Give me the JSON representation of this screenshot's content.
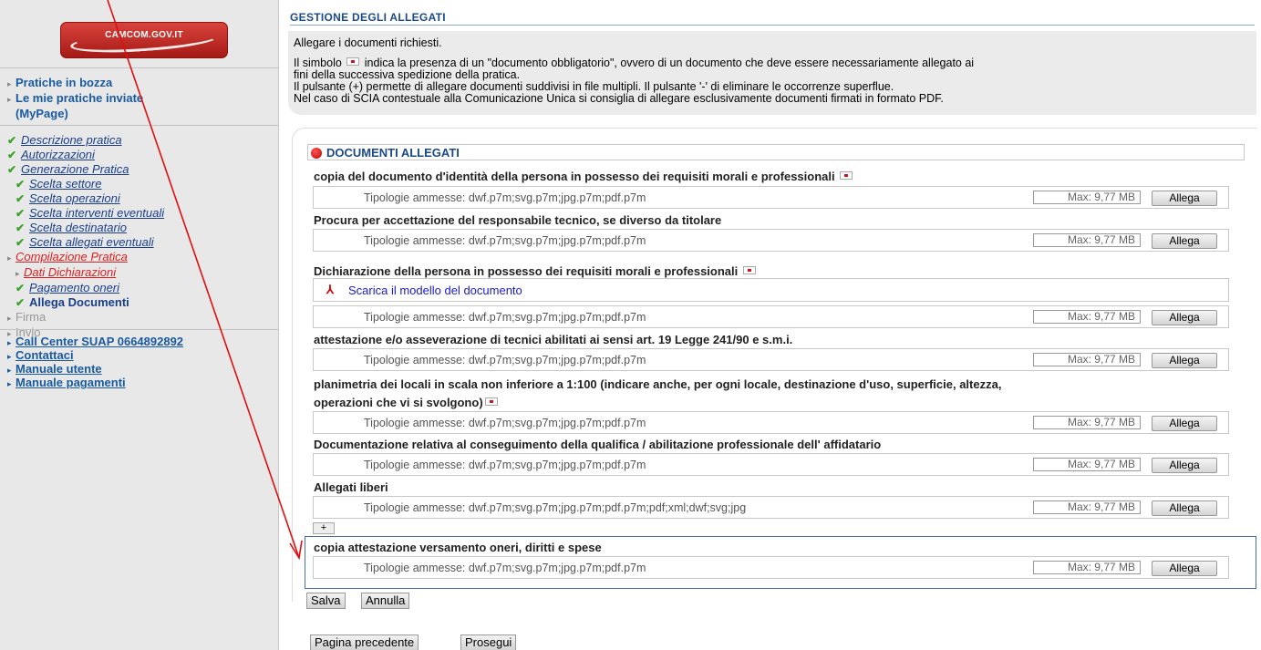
{
  "sidebar": {
    "logo_text": "CAMCOM.GOV.IT",
    "top_links": [
      "Pratiche in bozza",
      "Le mie pratiche inviate",
      "(MyPage)"
    ],
    "steps": [
      {
        "label": "Descrizione pratica"
      },
      {
        "label": "Autorizzazioni"
      },
      {
        "label": "Generazione Pratica"
      },
      {
        "label": "Scelta settore"
      },
      {
        "label": "Scelta operazioni"
      },
      {
        "label": "Scelta interventi eventuali"
      },
      {
        "label": "Scelta destinatario"
      },
      {
        "label": "Scelta allegati eventuali"
      },
      {
        "label": "Compilazione Pratica"
      },
      {
        "label": "Dati Dichiarazioni"
      },
      {
        "label": "Pagamento oneri"
      },
      {
        "label": "Allega Documenti"
      },
      {
        "label": "Firma"
      },
      {
        "label": "Invio"
      }
    ],
    "help_links": [
      "Call Center SUAP 0664892892",
      "Contattaci",
      "Manuale utente",
      "Manuale pagamenti"
    ]
  },
  "main": {
    "section_title": "GESTIONE DEGLI ALLEGATI",
    "info": {
      "line1": "Allegare i documenti richiesti.",
      "line2a": "Il simbolo",
      "line2b": "indica la presenza di un \"documento obbligatorio\", ovvero di un documento che deve essere necessariamente allegato ai",
      "line3": "fini della successiva spedizione della pratica.",
      "line4": "Il pulsante (+) permette di allegare documenti suddivisi in file multipli. Il pulsante '-' di eliminare le occorrenze superflue.",
      "line5": "Nel caso di SCIA contestuale alla Comunicazione Unica si consiglia di allegare esclusivamente documenti firmati in formato PDF."
    },
    "docs_header": "DOCUMENTI ALLEGATI",
    "download_link": "Scarica il modello del documento",
    "documents": [
      {
        "label": "copia del documento d'identità della persona in possesso dei requisiti morali e professionali",
        "types": "Tipologie ammesse: dwf.p7m;svg.p7m;jpg.p7m;pdf.p7m",
        "max": "Max: 9,77 MB",
        "button": "Allega"
      },
      {
        "label": "Procura per accettazione del responsabile tecnico, se diverso da titolare",
        "types": "Tipologie ammesse: dwf.p7m;svg.p7m;jpg.p7m;pdf.p7m",
        "max": "Max: 9,77 MB",
        "button": "Allega"
      },
      {
        "label": "Dichiarazione della persona in possesso dei requisiti morali e professionali",
        "types": "Tipologie ammesse: dwf.p7m;svg.p7m;jpg.p7m;pdf.p7m",
        "max": "Max: 9,77 MB",
        "button": "Allega"
      },
      {
        "label": "attestazione e/o asseverazione di tecnici abilitati ai sensi art. 19 Legge 241/90 e s.m.i.",
        "types": "Tipologie ammesse: dwf.p7m;svg.p7m;jpg.p7m;pdf.p7m",
        "max": "Max: 9,77 MB",
        "button": "Allega"
      },
      {
        "label": "planimetria dei locali in scala non inferiore a 1:100 (indicare anche, per ogni locale, destinazione d'uso, superficie, altezza,",
        "label2": "operazioni che vi si svolgono)",
        "types": "Tipologie ammesse: dwf.p7m;svg.p7m;jpg.p7m;pdf.p7m",
        "max": "Max: 9,77 MB",
        "button": "Allega"
      },
      {
        "label": "Documentazione relativa al conseguimento della qualifica / abilitazione professionale dell' affidatario",
        "types": "Tipologie ammesse: dwf.p7m;svg.p7m;jpg.p7m;pdf.p7m",
        "max": "Max: 9,77 MB",
        "button": "Allega"
      },
      {
        "label": "Allegati liberi",
        "types": "Tipologie ammesse: dwf.p7m;svg.p7m;jpg.p7m;pdf.p7m;pdf;xml;dwf;svg;jpg",
        "max": "Max: 9,77 MB",
        "button": "Allega"
      },
      {
        "label": "copia attestazione versamento oneri, diritti e spese",
        "types": "Tipologie ammesse: dwf.p7m;svg.p7m;jpg.p7m;pdf.p7m",
        "max": "Max: 9,77 MB",
        "button": "Allega"
      }
    ],
    "plus_label": "+",
    "buttons": {
      "save": "Salva",
      "cancel": "Annulla",
      "prev": "Pagina precedente",
      "next": "Prosegui"
    }
  },
  "colors": {
    "annotation_arrow": "#e01010",
    "accent_blue": "#1a4a8a"
  }
}
